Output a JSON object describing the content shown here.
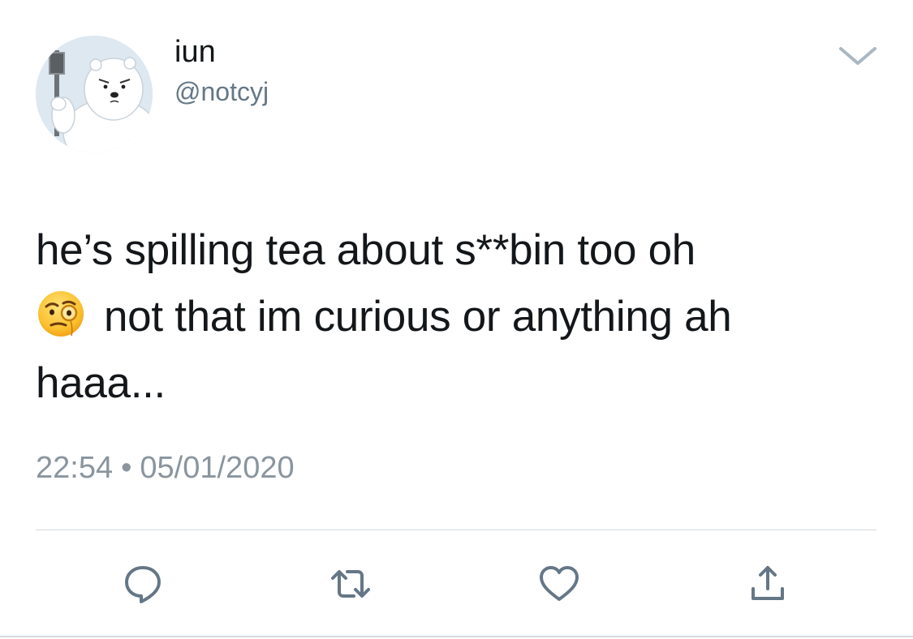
{
  "tweet": {
    "display_name": "iun",
    "handle": "@notcyj",
    "text_lines": [
      "he’s spilling tea about s**bin too oh",
      "not that im curious or anything ah",
      "haaa..."
    ],
    "emoji": "face-with-monocle",
    "time": "22:54",
    "separator": "•",
    "date": "05/01/2020"
  },
  "actions": {
    "reply_icon": "reply-icon",
    "retweet_icon": "retweet-icon",
    "like_icon": "heart-icon",
    "share_icon": "share-icon"
  },
  "colors": {
    "text": "#14171a",
    "muted": "#8a959e",
    "icon": "#657786",
    "divider": "#d4d9dd"
  }
}
